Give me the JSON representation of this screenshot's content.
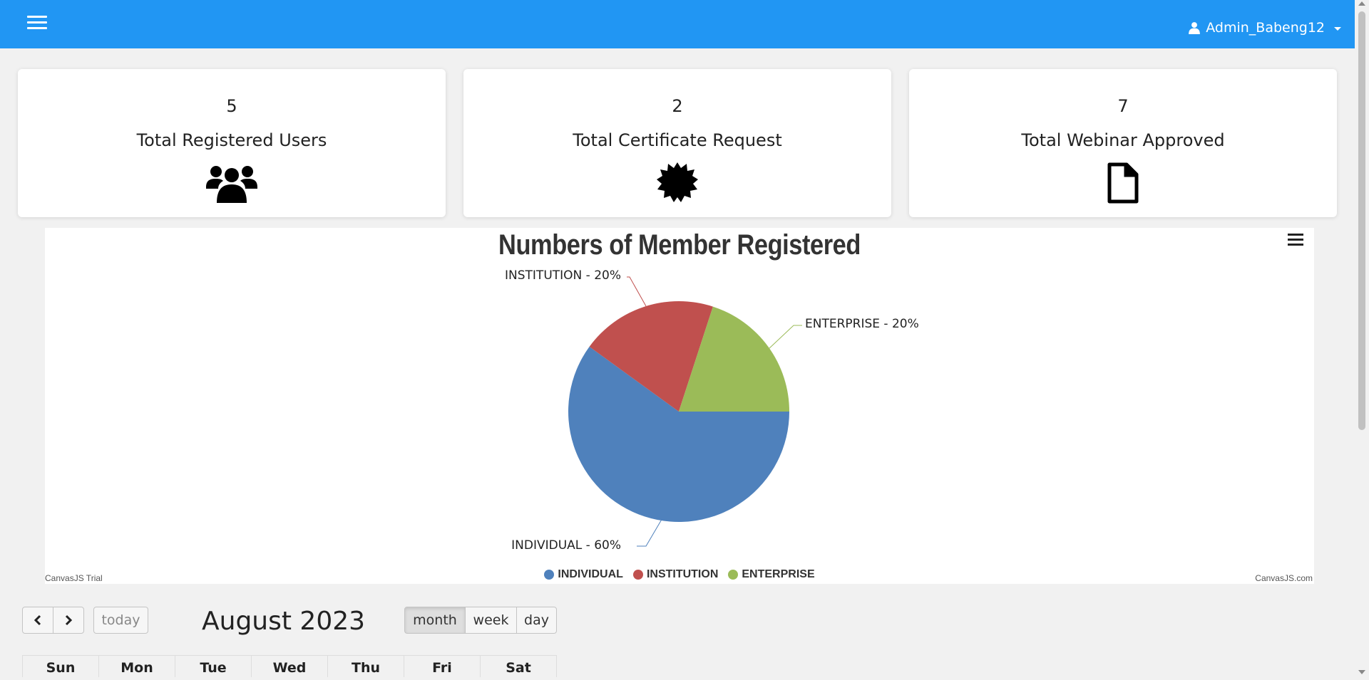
{
  "header": {
    "menu_icon": "hamburger-menu-icon",
    "user_icon": "user-icon",
    "username": "Admin_Babeng12",
    "accent_color": "#2196f3"
  },
  "stats": [
    {
      "value": "5",
      "label": "Total Registered Users",
      "icon": "users-icon"
    },
    {
      "value": "2",
      "label": "Total Certificate Request",
      "icon": "certificate-badge-icon"
    },
    {
      "value": "7",
      "label": "Total Webinar Approved",
      "icon": "document-icon"
    }
  ],
  "chart_data": {
    "type": "pie",
    "title": "Numbers of Member Registered",
    "slices": [
      {
        "name": "INDIVIDUAL",
        "percent": 60,
        "label": "INDIVIDUAL - 60%",
        "color": "#4f81bc"
      },
      {
        "name": "INSTITUTION",
        "percent": 20,
        "label": "INSTITUTION - 20%",
        "color": "#c0504e"
      },
      {
        "name": "ENTERPRISE",
        "percent": 20,
        "label": "ENTERPRISE - 20%",
        "color": "#9bbb58"
      }
    ],
    "legend": [
      "INDIVIDUAL",
      "INSTITUTION",
      "ENTERPRISE"
    ],
    "legend_placement": "bottom",
    "watermark_left": "CanvasJS Trial",
    "watermark_right": "CanvasJS.com"
  },
  "calendar": {
    "prev_icon": "chevron-left-icon",
    "next_icon": "chevron-right-icon",
    "today_label": "today",
    "title": "August 2023",
    "views": [
      "month",
      "week",
      "day"
    ],
    "active_view": "month",
    "weekdays": [
      "Sun",
      "Mon",
      "Tue",
      "Wed",
      "Thu",
      "Fri",
      "Sat"
    ]
  }
}
